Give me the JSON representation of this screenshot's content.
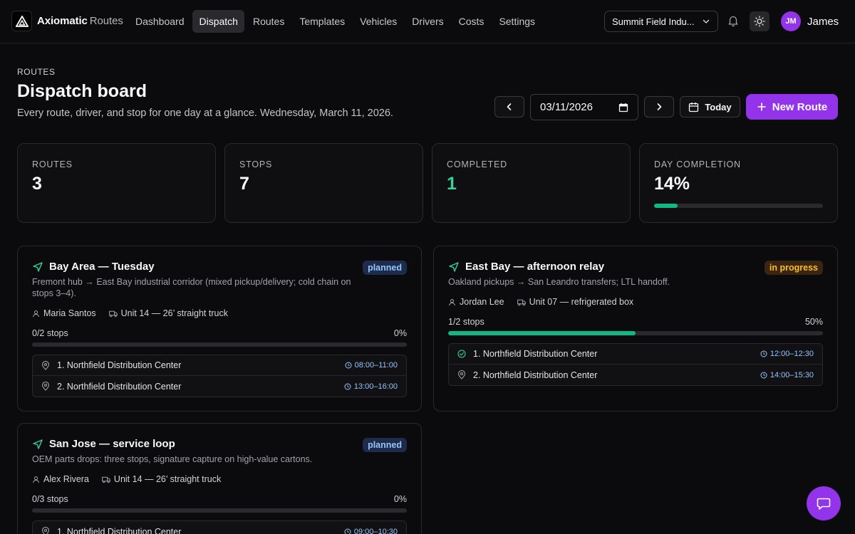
{
  "header": {
    "brand": "Axiomatic",
    "brand_sub": "Routes",
    "nav": [
      "Dashboard",
      "Dispatch",
      "Routes",
      "Templates",
      "Vehicles",
      "Drivers",
      "Costs",
      "Settings"
    ],
    "active_nav": "Dispatch",
    "org": "Summit Field Indu...",
    "user_initials": "JM",
    "user_name": "James"
  },
  "page": {
    "eyebrow": "ROUTES",
    "title": "Dispatch board",
    "subtitle": "Every route, driver, and stop for one day at a glance. Wednesday, March 11, 2026.",
    "date_value": "03/11/2026",
    "today_label": "Today",
    "new_route_label": "New Route"
  },
  "stats": [
    {
      "label": "ROUTES",
      "value": "3"
    },
    {
      "label": "STOPS",
      "value": "7"
    },
    {
      "label": "COMPLETED",
      "value": "1"
    },
    {
      "label": "DAY COMPLETION",
      "value": "14%",
      "progress": 0.14
    }
  ],
  "routes": [
    {
      "title": "Bay Area — Tuesday",
      "status": "planned",
      "description": "Fremont hub → East Bay industrial corridor (mixed pickup/delivery; cold chain on stops 3–4).",
      "driver": "Maria Santos",
      "vehicle": "Unit 14 — 26’ straight truck",
      "stops_count": "0/2 stops",
      "pct": "0%",
      "progress": 0,
      "stops": [
        {
          "name": "1. Northfield Distribution Center",
          "time": "08:00–11:00",
          "done": false
        },
        {
          "name": "2. Northfield Distribution Center",
          "time": "13:00–16:00",
          "done": false
        }
      ]
    },
    {
      "title": "East Bay — afternoon relay",
      "status": "in progress",
      "description": "Oakland pickups → San Leandro transfers; LTL handoff.",
      "driver": "Jordan Lee",
      "vehicle": "Unit 07 — refrigerated box",
      "stops_count": "1/2 stops",
      "pct": "50%",
      "progress": 0.5,
      "stops": [
        {
          "name": "1. Northfield Distribution Center",
          "time": "12:00–12:30",
          "done": true
        },
        {
          "name": "2. Northfield Distribution Center",
          "time": "14:00–15:30",
          "done": false
        }
      ]
    },
    {
      "title": "San Jose — service loop",
      "status": "planned",
      "description": "OEM parts drops: three stops, signature capture on high-value cartons.",
      "driver": "Alex Rivera",
      "vehicle": "Unit 14 — 26’ straight truck",
      "stops_count": "0/3 stops",
      "pct": "0%",
      "progress": 0,
      "stops": [
        {
          "name": "1. Northfield Distribution Center",
          "time": "09:00–10:30",
          "done": false
        }
      ]
    }
  ],
  "colors": {
    "accent": "#9333ea",
    "success": "#10b981",
    "planned_badge": "#93c5fd",
    "in_progress_badge": "#fbbf24"
  },
  "icons": [
    "logo-icon",
    "chevron-down-icon",
    "bell-icon",
    "sun-icon",
    "chevron-left-icon",
    "chevron-right-icon",
    "calendar-icon",
    "plus-icon",
    "navigation-icon",
    "user-icon",
    "truck-icon",
    "map-pin-icon",
    "clock-icon",
    "check-circle-icon",
    "chat-icon"
  ]
}
